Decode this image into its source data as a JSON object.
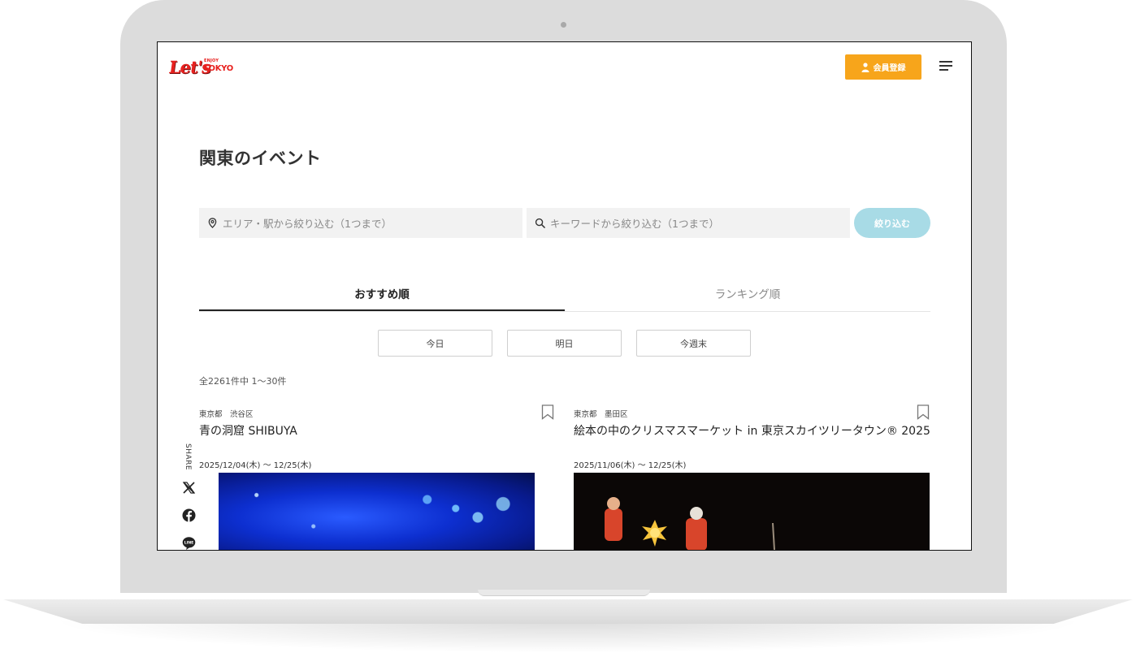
{
  "header": {
    "logo_text": "Let's",
    "logo_enjoy": "ENJOY",
    "logo_tokyo": "TOKYO",
    "member_button": "会員登録",
    "menu_icon": "hamburger-menu-icon"
  },
  "page": {
    "title": "関東のイベント"
  },
  "search": {
    "area_placeholder": "エリア・駅から絞り込む（1つまで）",
    "keyword_placeholder": "キーワードから絞り込む（1つまで）",
    "filter_button": "絞り込む"
  },
  "tabs": [
    {
      "label": "おすすめ順",
      "active": true
    },
    {
      "label": "ランキング順",
      "active": false
    }
  ],
  "day_filters": [
    "今日",
    "明日",
    "今週末"
  ],
  "results": {
    "count_text": "全2261件中 1〜30件"
  },
  "events": [
    {
      "area": "東京都　渋谷区",
      "title": "青の洞窟 SHIBUYA",
      "date": "2025/12/04(木) 〜 12/25(木)"
    },
    {
      "area": "東京都　墨田区",
      "title": "絵本の中のクリスマスマーケット in 東京スカイツリータウン® 2025",
      "date": "2025/11/06(木) 〜 12/25(木)"
    }
  ],
  "share": {
    "label": "SHARE",
    "icons": [
      "x-icon",
      "facebook-icon",
      "line-icon"
    ]
  },
  "colors": {
    "accent_orange": "#f7a51b",
    "filter_button": "#a8dbe6",
    "logo_red": "#e8211f"
  }
}
